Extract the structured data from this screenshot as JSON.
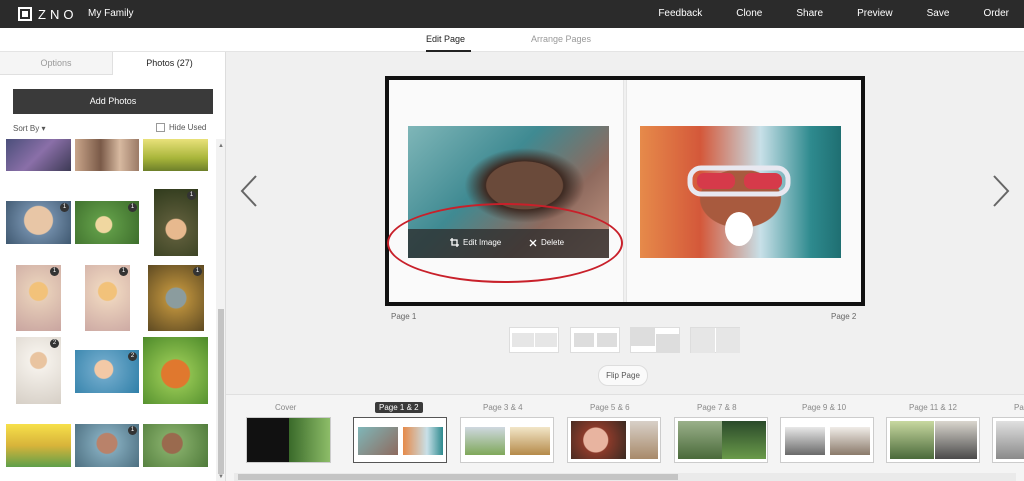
{
  "header": {
    "logo_text": "ZNO",
    "project_title": "My Family",
    "nav": [
      "Feedback",
      "Clone",
      "Share",
      "Preview",
      "Save",
      "Order"
    ]
  },
  "subtabs": {
    "edit_page": "Edit Page",
    "arrange_pages": "Arrange Pages",
    "active": "Edit Page"
  },
  "sidebar": {
    "tab_options": "Options",
    "tab_photos": "Photos (27)",
    "add_photos": "Add Photos",
    "sort_by": "Sort By",
    "hide_used": "Hide Used",
    "badges": [
      "1",
      "1",
      "1",
      "1",
      "1",
      "1",
      "2",
      "1"
    ]
  },
  "editor": {
    "edit_image": "Edit Image",
    "delete": "Delete",
    "page_left": "Page 1",
    "page_right": "Page 2",
    "flip_page": "Flip Page"
  },
  "filmstrip": {
    "spreads": [
      "Cover",
      "Page 1 & 2",
      "Page 3 & 4",
      "Page 5 & 6",
      "Page 7 & 8",
      "Page 9 & 10",
      "Page 11 & 12",
      "Pa"
    ],
    "current": "Page 1 & 2"
  },
  "colors": {
    "topbar": "#2b2b2b",
    "annotation": "#c8202a",
    "button": "#3a3a3a"
  },
  "icons": [
    "logo-icon",
    "chevron-down-icon",
    "crop-icon",
    "close-icon",
    "arrow-left-icon",
    "arrow-right-icon"
  ]
}
